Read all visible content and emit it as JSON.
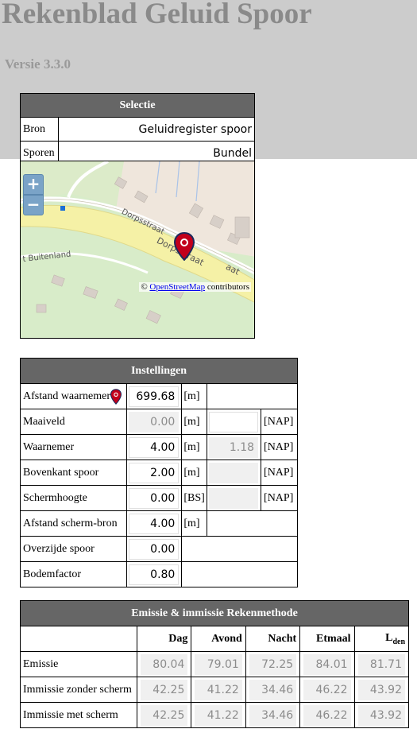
{
  "header": {
    "title": "Rekenblad Geluid Spoor",
    "version": "Versie 3.3.0"
  },
  "selectie": {
    "title": "Selectie",
    "rows": [
      {
        "label": "Bron",
        "value": "Geluidregister spoor"
      },
      {
        "label": "Sporen",
        "value": "Bundel"
      }
    ]
  },
  "map": {
    "zoom_in": "+",
    "zoom_out": "−",
    "streets": [
      "Dorpsstraat",
      "Dorpsstraat",
      "t Buitenland",
      "ssu",
      "aat"
    ],
    "attribution_prefix": "©",
    "attribution_link": "OpenStreetMap",
    "attribution_suffix": "contributors",
    "marker_icon": "map-marker-icon",
    "colors": {
      "land": "#d8ecc9",
      "built": "#efe6dc",
      "rail": "#f5f1a6",
      "road": "#ffffff",
      "marker": "#c2001b"
    }
  },
  "instellingen": {
    "title": "Instellingen",
    "rows": [
      {
        "label": "Afstand waarnemer",
        "value": "699.68",
        "unit": "[m]",
        "readonly": false,
        "pin": true
      },
      {
        "label": "Maaiveld",
        "value": "0.00",
        "unit": "[m]",
        "nap_value": "",
        "nap_unit": "[NAP]",
        "readonly": true
      },
      {
        "label": "Waarnemer",
        "value": "4.00",
        "unit": "[m]",
        "nap_value": "1.18",
        "nap_unit": "[NAP]",
        "readonly": false
      },
      {
        "label": "Bovenkant spoor",
        "value": "2.00",
        "unit": "[m]",
        "nap_value": "",
        "nap_unit": "[NAP]",
        "readonly": false
      },
      {
        "label": "Schermhoogte",
        "value": "0.00",
        "unit": "[BS]",
        "nap_value": "",
        "nap_unit": "[NAP]",
        "readonly": false
      },
      {
        "label": "Afstand scherm-bron",
        "value": "4.00",
        "unit": "[m]",
        "readonly": false
      },
      {
        "label": "Overzijde spoor",
        "value": "0.00",
        "readonly": false
      },
      {
        "label": "Bodemfactor",
        "value": "0.80",
        "readonly": false
      }
    ]
  },
  "emissie": {
    "title": "Emissie & immissie Rekenmethode",
    "columns": [
      "Dag",
      "Avond",
      "Nacht",
      "Etmaal",
      "L",
      "den"
    ],
    "rows": [
      {
        "label": "Emissie",
        "values": [
          "80.04",
          "79.01",
          "72.25",
          "84.01",
          "81.71"
        ]
      },
      {
        "label": "Immissie zonder scherm",
        "values": [
          "42.25",
          "41.22",
          "34.46",
          "46.22",
          "43.92"
        ]
      },
      {
        "label": "Immissie met scherm",
        "values": [
          "42.25",
          "41.22",
          "34.46",
          "46.22",
          "43.92"
        ]
      }
    ]
  }
}
